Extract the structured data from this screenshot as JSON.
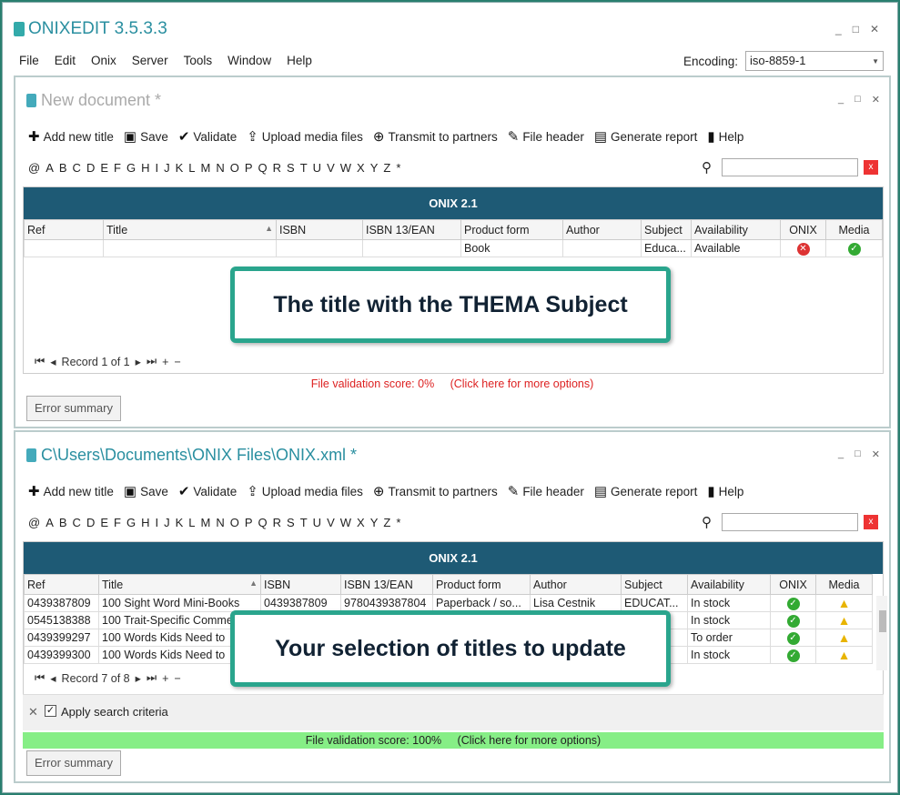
{
  "app": {
    "title": "ONIXEDIT 3.5.3.3",
    "window_controls": [
      "_",
      "□",
      "✕"
    ]
  },
  "menu": [
    "File",
    "Edit",
    "Onix",
    "Server",
    "Tools",
    "Window",
    "Help"
  ],
  "encoding": {
    "label": "Encoding:",
    "value": "iso-8859-1"
  },
  "toolbar": {
    "add": "Add new title",
    "save": "Save",
    "validate": "Validate",
    "upload": "Upload media files",
    "transmit": "Transmit to partners",
    "header": "File header",
    "report": "Generate report",
    "help": "Help"
  },
  "alphabet": [
    "@",
    "A",
    "B",
    "C",
    "D",
    "E",
    "F",
    "G",
    "H",
    "I",
    "J",
    "K",
    "L",
    "M",
    "N",
    "O",
    "P",
    "Q",
    "R",
    "S",
    "T",
    "U",
    "V",
    "W",
    "X",
    "Y",
    "Z",
    "*"
  ],
  "clear_label": "x",
  "panel1": {
    "title": "New document *",
    "grid_title": "ONIX 2.1",
    "columns": [
      "Ref",
      "Title",
      "ISBN",
      "ISBN 13/EAN",
      "Product form",
      "Author",
      "Subject",
      "Availability",
      "ONIX",
      "Media"
    ],
    "sort_arrow": "▲",
    "rows": [
      {
        "ref": "",
        "title": "",
        "isbn": "",
        "ean": "",
        "form": "Book",
        "author": "",
        "subject": "Educa...",
        "availability": "Available",
        "onix": "bad",
        "media": "ok"
      }
    ],
    "record": "Record 1 of 1",
    "score": "File validation score: 0%",
    "options": "(Click here for more options)",
    "error_btn": "Error summary",
    "callout": "The title with the THEMA Subject"
  },
  "panel2": {
    "title": "C\\Users\\Documents\\ONIX Files\\ONIX.xml *",
    "grid_title": "ONIX 2.1",
    "columns": [
      "Ref",
      "Title",
      "ISBN",
      "ISBN 13/EAN",
      "Product form",
      "Author",
      "Subject",
      "Availability",
      "ONIX",
      "Media"
    ],
    "sort_arrow": "▲",
    "rows": [
      {
        "ref": "0439387809",
        "title": "100 Sight Word Mini-Books",
        "isbn": "0439387809",
        "ean": "9780439387804",
        "form": "Paperback / so...",
        "author": "Lisa Cestnik",
        "subject": "EDUCAT...",
        "availability": "In stock",
        "onix": "ok",
        "media": "warn"
      },
      {
        "ref": "0545138388",
        "title": "100 Trait-Specific Comme",
        "isbn": "",
        "ean": "",
        "form": "",
        "author": "",
        "subject": "",
        "availability": "In stock",
        "onix": "ok",
        "media": "warn"
      },
      {
        "ref": "0439399297",
        "title": "100 Words Kids Need to",
        "isbn": "",
        "ean": "",
        "form": "",
        "author": "",
        "subject": "",
        "availability": "To order",
        "onix": "ok",
        "media": "warn"
      },
      {
        "ref": "0439399300",
        "title": "100 Words Kids Need to",
        "isbn": "",
        "ean": "",
        "form": "",
        "author": "",
        "subject": "",
        "availability": "In stock",
        "onix": "ok",
        "media": "warn"
      }
    ],
    "record": "Record 7 of 8",
    "filter_label": "Apply search criteria",
    "score": "File validation score: 100%",
    "options": "(Click here for more options)",
    "error_btn": "Error summary",
    "callout": "Your selection of titles to update"
  }
}
